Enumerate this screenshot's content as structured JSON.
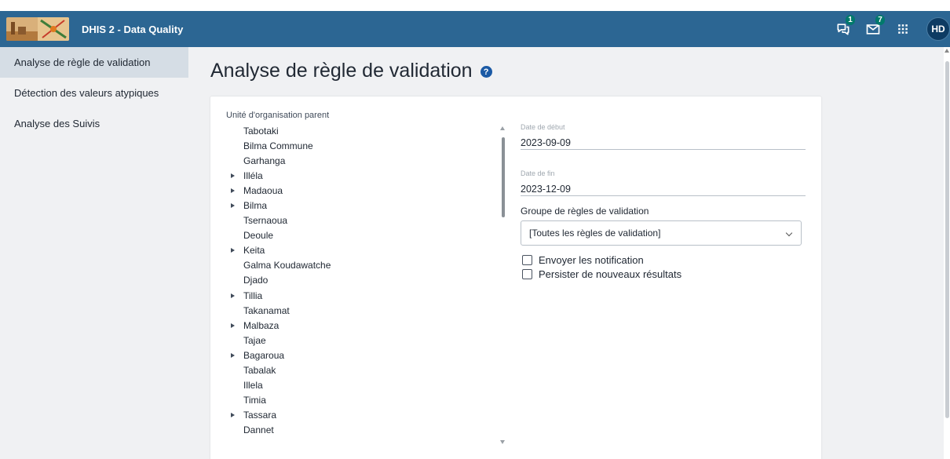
{
  "header": {
    "app_title": "DHIS 2 - Data Quality",
    "interpretations_badge": "1",
    "messages_badge": "7",
    "avatar_initials": "HD",
    "colors": {
      "bar": "#2c6693",
      "badge": "#00796b"
    }
  },
  "sidebar": {
    "items": [
      {
        "label": "Analyse de règle de validation",
        "active": true
      },
      {
        "label": "Détection des valeurs atypiques",
        "active": false
      },
      {
        "label": "Analyse des Suivis",
        "active": false
      }
    ]
  },
  "main": {
    "title": "Analyse de règle de validation",
    "help_icon": "question-circle-icon",
    "org_unit_label": "Unité d'organisation parent",
    "org_units": [
      {
        "name": "Tabotaki",
        "expandable": false
      },
      {
        "name": "Bilma Commune",
        "expandable": false
      },
      {
        "name": "Garhanga",
        "expandable": false
      },
      {
        "name": "Illéla",
        "expandable": true
      },
      {
        "name": "Madaoua",
        "expandable": true
      },
      {
        "name": "Bilma",
        "expandable": true
      },
      {
        "name": "Tsernaoua",
        "expandable": false
      },
      {
        "name": "Deoule",
        "expandable": false
      },
      {
        "name": "Keita",
        "expandable": true
      },
      {
        "name": "Galma Koudawatche",
        "expandable": false
      },
      {
        "name": "Djado",
        "expandable": false
      },
      {
        "name": "Tillia",
        "expandable": true
      },
      {
        "name": "Takanamat",
        "expandable": false
      },
      {
        "name": "Malbaza",
        "expandable": true
      },
      {
        "name": "Tajae",
        "expandable": false
      },
      {
        "name": "Bagaroua",
        "expandable": true
      },
      {
        "name": "Tabalak",
        "expandable": false
      },
      {
        "name": "Illela",
        "expandable": false
      },
      {
        "name": "Timia",
        "expandable": false
      },
      {
        "name": "Tassara",
        "expandable": true
      },
      {
        "name": "Dannet",
        "expandable": false
      }
    ],
    "start_date": {
      "label": "Date de début",
      "value": "2023-09-09"
    },
    "end_date": {
      "label": "Date de fin",
      "value": "2023-12-09"
    },
    "rule_group": {
      "label": "Groupe de règles de validation",
      "selected": "[Toutes les règles de validation]"
    },
    "checkboxes": {
      "notify": {
        "label": "Envoyer les notification",
        "checked": false
      },
      "persist": {
        "label": "Persister de nouveaux résultats",
        "checked": false
      }
    }
  }
}
